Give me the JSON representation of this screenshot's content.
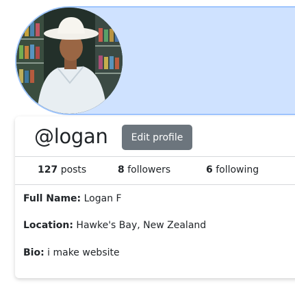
{
  "profile": {
    "handle": "@logan",
    "edit_button": "Edit profile",
    "avatar_alt": "profile photo"
  },
  "stats": {
    "posts_count": "127",
    "posts_label": "posts",
    "followers_count": "8",
    "followers_label": "followers",
    "following_count": "6",
    "following_label": "following"
  },
  "details": {
    "full_name_label": "Full Name:",
    "full_name_value": "Logan F",
    "location_label": "Location:",
    "location_value": "Hawke's Bay, New Zealand",
    "bio_label": "Bio:",
    "bio_value": "i make website"
  },
  "colors": {
    "banner": "#cfe2ff",
    "button": "#6c757d"
  }
}
